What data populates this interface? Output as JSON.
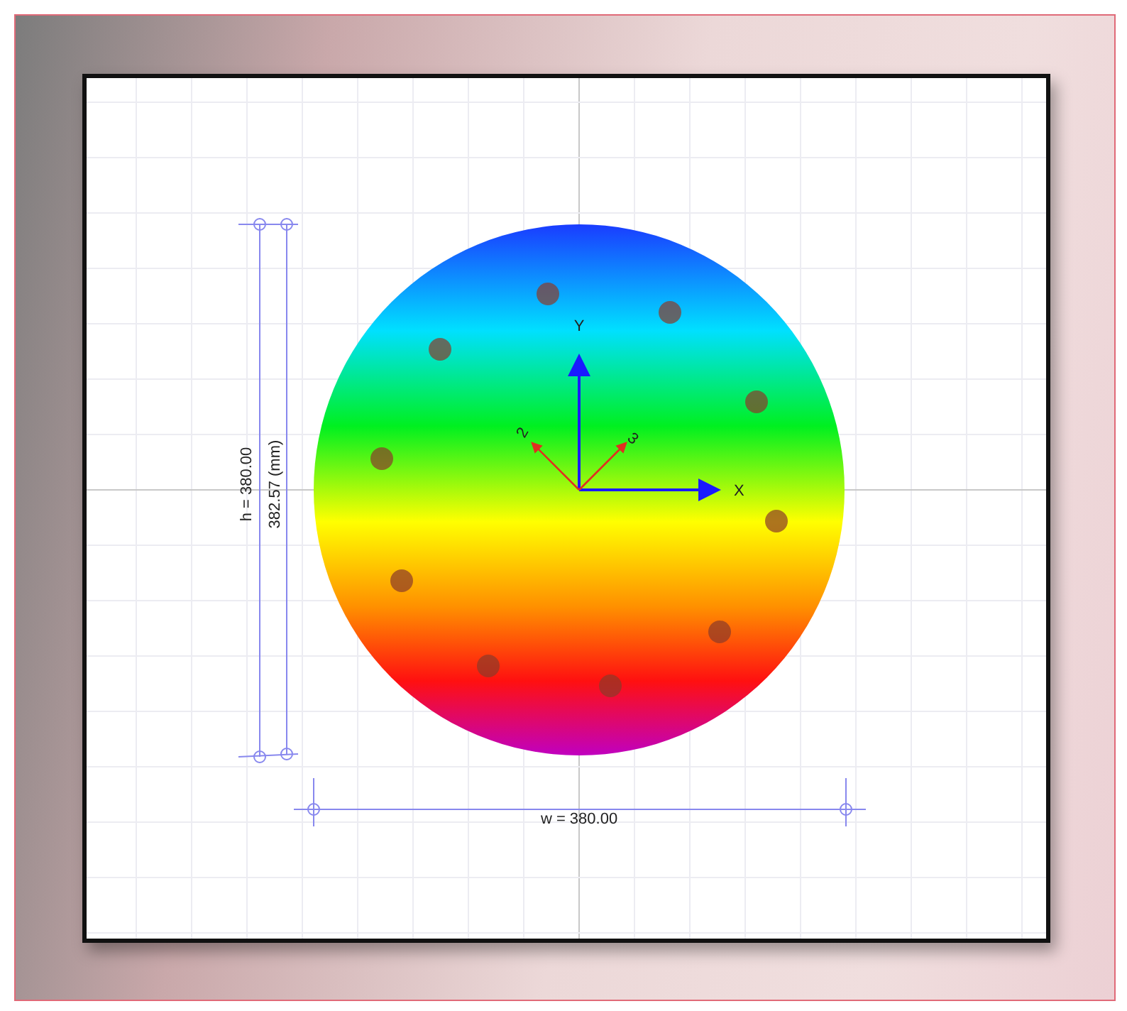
{
  "axes": {
    "y_label": "Y",
    "x_label": "X",
    "axis_2_label": "2",
    "axis_3_label": "3"
  },
  "dimensions": {
    "height_label": "h = 380.00",
    "length_label": "382.57 (mm)",
    "width_label": "w = 380.00"
  }
}
